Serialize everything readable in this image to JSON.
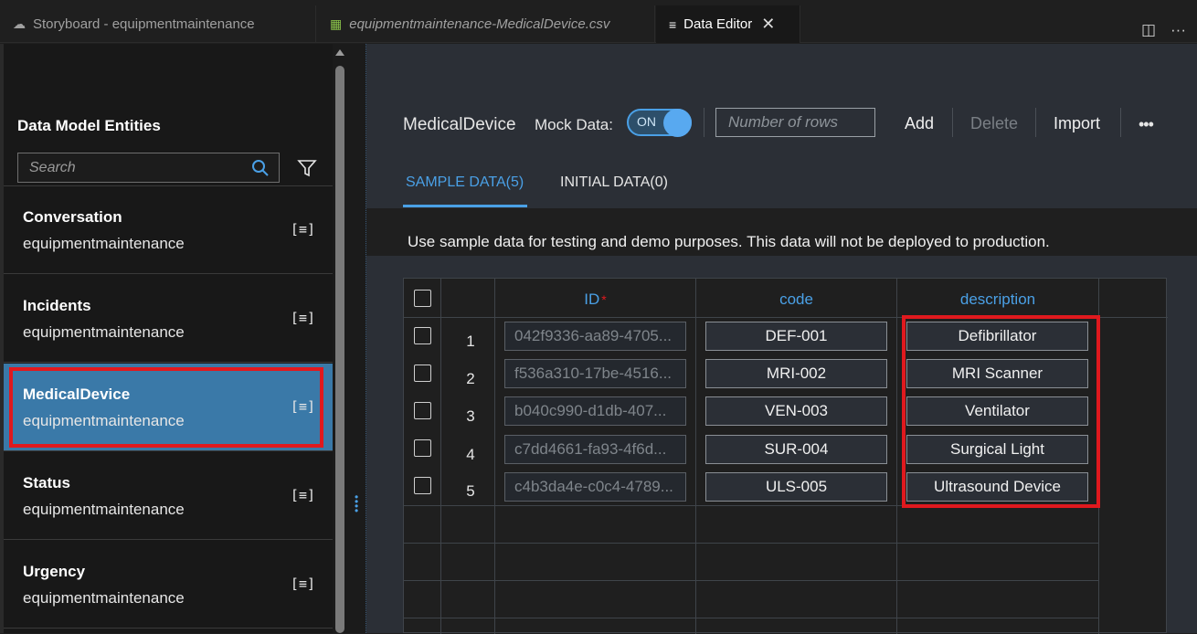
{
  "tabs": [
    {
      "label": "Storyboard - equipmentmaintenance",
      "icon": "cloud-icon"
    },
    {
      "label": "equipmentmaintenance-MedicalDevice.csv",
      "icon": "csv-file-icon"
    },
    {
      "label": "Data Editor",
      "icon": "list-icon"
    }
  ],
  "sidebar": {
    "title": "Data Model Entities",
    "search_placeholder": "Search",
    "entities": [
      {
        "name": "Conversation",
        "namespace": "equipmentmaintenance"
      },
      {
        "name": "Incidents",
        "namespace": "equipmentmaintenance"
      },
      {
        "name": "MedicalDevice",
        "namespace": "equipmentmaintenance"
      },
      {
        "name": "Status",
        "namespace": "equipmentmaintenance"
      },
      {
        "name": "Urgency",
        "namespace": "equipmentmaintenance"
      }
    ],
    "entity_icon": "[≡]"
  },
  "editor": {
    "entity_title": "MedicalDevice",
    "mock_label": "Mock Data:",
    "toggle_label": "ON",
    "rows_placeholder": "Number of rows",
    "add_label": "Add",
    "delete_label": "Delete",
    "import_label": "Import",
    "more_label": "•••",
    "tab_sample": "SAMPLE DATA(5)",
    "tab_initial": "INITIAL DATA(0)",
    "info": "Use sample data for testing and demo purposes. This data will not be deployed to production."
  },
  "table": {
    "headers": {
      "id": "ID",
      "required": "*",
      "code": "code",
      "description": "description"
    },
    "rows": [
      {
        "num": "1",
        "id": "042f9336-aa89-4705...",
        "code": "DEF-001",
        "description": "Defibrillator"
      },
      {
        "num": "2",
        "id": "f536a310-17be-4516...",
        "code": "MRI-002",
        "description": "MRI Scanner"
      },
      {
        "num": "3",
        "id": "b040c990-d1db-407...",
        "code": "VEN-003",
        "description": "Ventilator"
      },
      {
        "num": "4",
        "id": "c7dd4661-fa93-4f6d...",
        "code": "SUR-004",
        "description": "Surgical Light"
      },
      {
        "num": "5",
        "id": "c4b3da4e-c0c4-4789...",
        "code": "ULS-005",
        "description": "Ultrasound Device"
      }
    ]
  },
  "colors": {
    "accent": "#4aa0e6",
    "selected": "#3a79a8",
    "highlight": "#e0191e"
  }
}
